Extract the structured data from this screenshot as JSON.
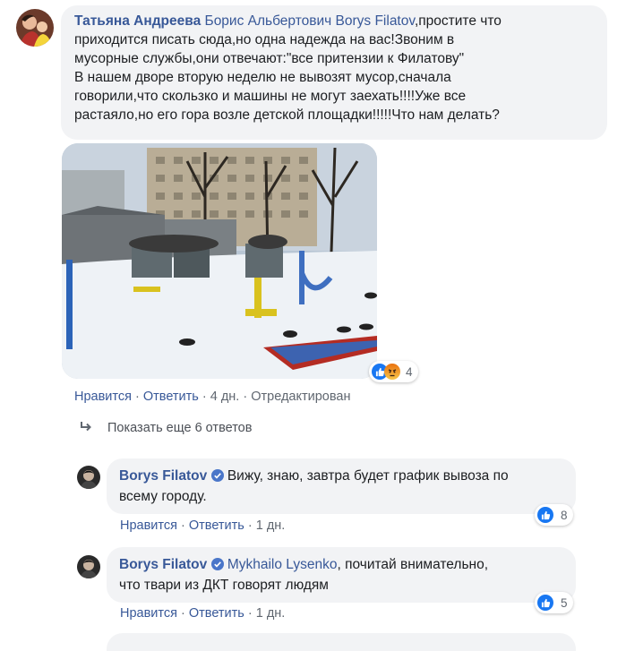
{
  "comment_main": {
    "author": "Татьяна Андреева",
    "mention1": "Борис Альбертович",
    "mention2": "Borys Filatov",
    "line1_tail": ",простите что",
    "lines": [
      "приходится писать сюда,но одна надежда на вас!Звоним в",
      "мусорные службы,они отвечают:\"все притензии к Филатову\"",
      "В нашем дворе вторую неделю не вывозят мусор,сначала",
      "говорили,что скользко и машины не могут заехать!!!!Уже все",
      "растаяло,но его гора возле детской площадки!!!!!Что нам делать?"
    ],
    "reactions_count": "4",
    "actions": {
      "like": "Нравится",
      "reply": "Ответить",
      "time": "4 дн.",
      "edited": "Отредактирован"
    }
  },
  "show_more": {
    "label": "Показать еще 6 ответов"
  },
  "replies": [
    {
      "author": "Borys Filatov",
      "text_line1": "Вижу, знаю, завтра будет график вывоза по",
      "text_line2": "всему городу.",
      "reactions_count": "8",
      "actions": {
        "like": "Нравится",
        "reply": "Ответить",
        "time": "1 дн."
      }
    },
    {
      "author": "Borys Filatov",
      "mention": "Mykhailo Lysenko",
      "text_line1_tail": ", почитай внимательно,",
      "text_line2": "что твари из ДКТ говорят людям",
      "reactions_count": "5",
      "actions": {
        "like": "Нравится",
        "reply": "Ответить",
        "time": "1 дн."
      }
    }
  ],
  "colors": {
    "link": "#385898",
    "bubble": "#f2f3f5",
    "like_blue": "#1877f2",
    "meta": "#606770"
  },
  "icons": [
    "verified-badge-icon",
    "reply-arrow-icon",
    "like-reaction-icon",
    "angry-reaction-icon"
  ]
}
